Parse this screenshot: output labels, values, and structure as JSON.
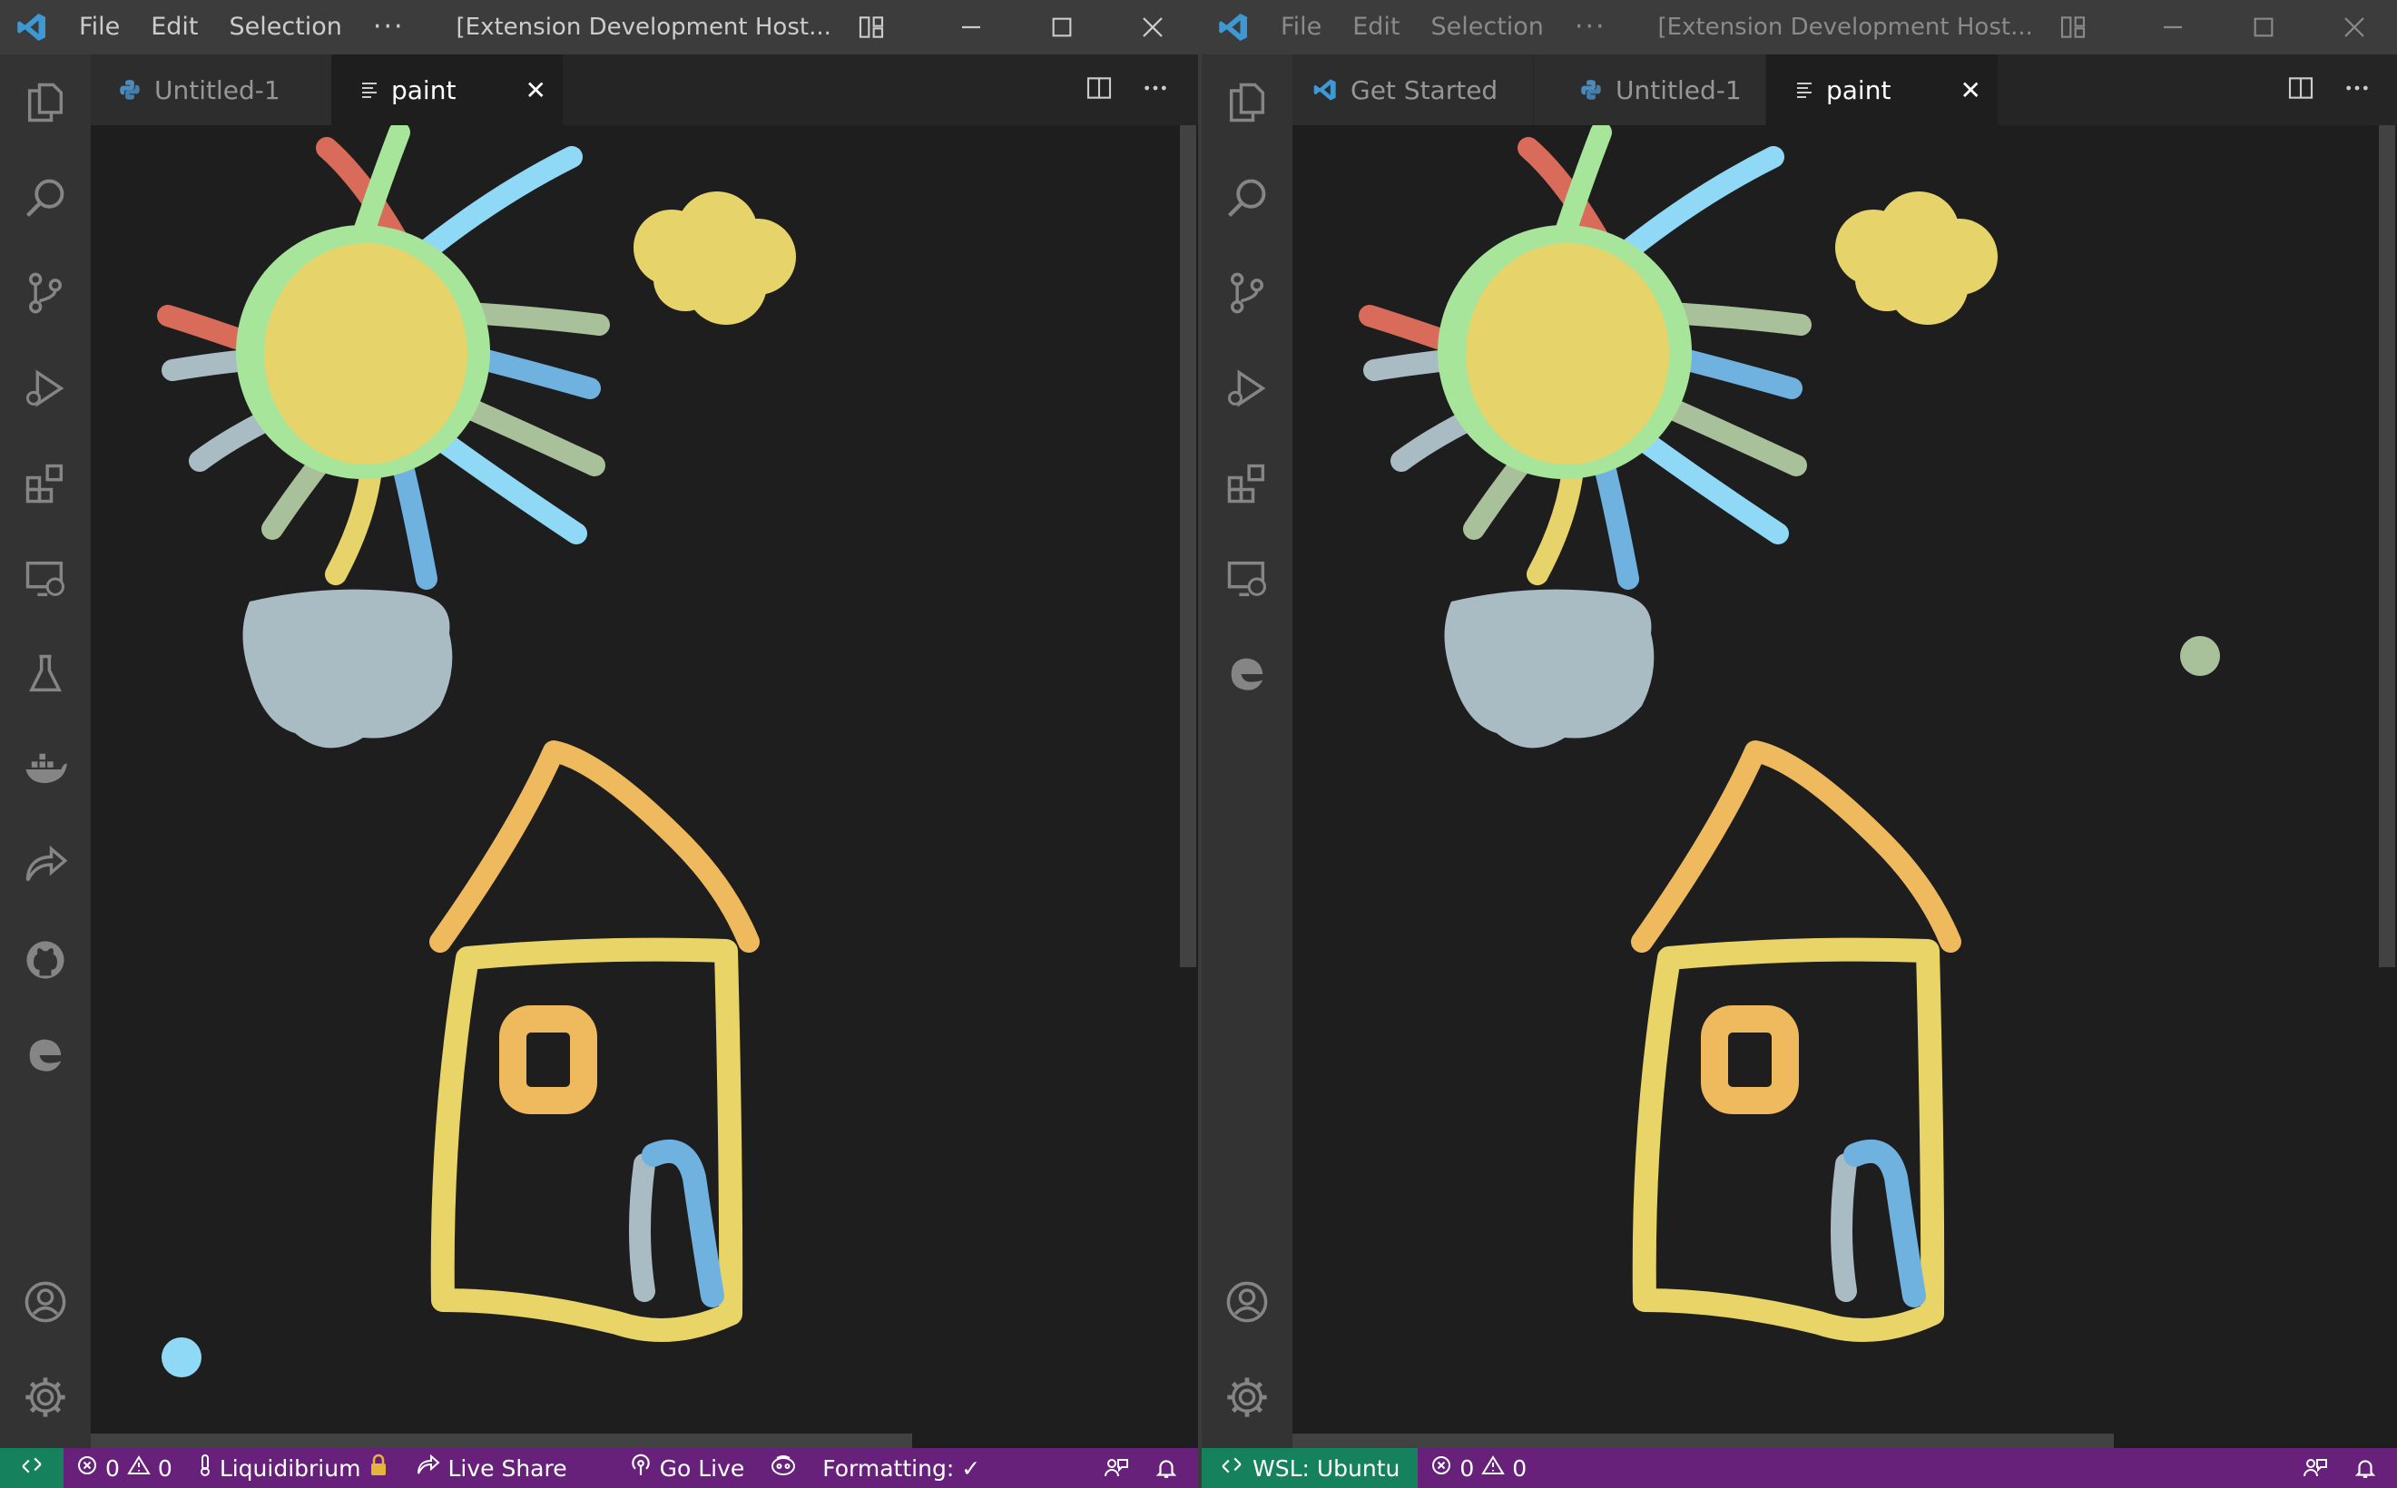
{
  "colors": {
    "titlebar": "#3c3c3c",
    "activitybar": "#333333",
    "editor": "#1e1e1e",
    "statusbar": "#68217a",
    "remote": "#16825d",
    "vscode_blue": "#3c99d4",
    "python_blue": "#4b8bbe"
  },
  "left_window": {
    "menu": [
      "File",
      "Edit",
      "Selection",
      "···"
    ],
    "title": "[Extension Development Host...",
    "activity_icons": [
      "explorer-icon",
      "search-icon",
      "source-control-icon",
      "run-debug-icon",
      "extensions-icon",
      "remote-explorer-icon",
      "testing-icon",
      "docker-icon",
      "live-share-icon",
      "github-icon",
      "edge-icon"
    ],
    "activity_bottom": [
      "accounts-icon",
      "settings-gear-icon"
    ],
    "tabs": [
      {
        "label": "Untitled-1",
        "icon": "python-icon",
        "active": false
      },
      {
        "label": "paint",
        "icon": "text-file-icon",
        "active": true,
        "close": "✕"
      }
    ],
    "status": {
      "remote_icon": "remote-icon",
      "errors": "0",
      "warnings": "0",
      "liquidibrium": "Liquidibrium",
      "live_share": "Live Share",
      "go_live": "Go Live",
      "formatting": "Formatting: ✓"
    }
  },
  "right_window": {
    "menu": [
      "File",
      "Edit",
      "Selection",
      "···"
    ],
    "title": "[Extension Development Host...",
    "activity_icons": [
      "explorer-icon",
      "search-icon",
      "source-control-icon",
      "run-debug-icon",
      "extensions-icon",
      "remote-explorer-icon",
      "edge-icon"
    ],
    "activity_bottom": [
      "accounts-icon",
      "settings-gear-icon"
    ],
    "tabs": [
      {
        "label": "Get Started",
        "icon": "vscode-icon",
        "active": false
      },
      {
        "label": "Untitled-1",
        "icon": "python-icon",
        "active": false
      },
      {
        "label": "paint",
        "icon": "text-file-icon",
        "active": true,
        "close": "✕"
      }
    ],
    "status": {
      "remote": "WSL: Ubuntu",
      "errors": "0",
      "warnings": "0"
    }
  },
  "painting": {
    "subject": "sun, clouds, house",
    "palette": [
      "#d96b5a",
      "#a6e59a",
      "#8fd9f7",
      "#e6d46a",
      "#a8c19a",
      "#6fb2e0",
      "#a9bcc4",
      "#efb95d",
      "#e8d467"
    ]
  }
}
